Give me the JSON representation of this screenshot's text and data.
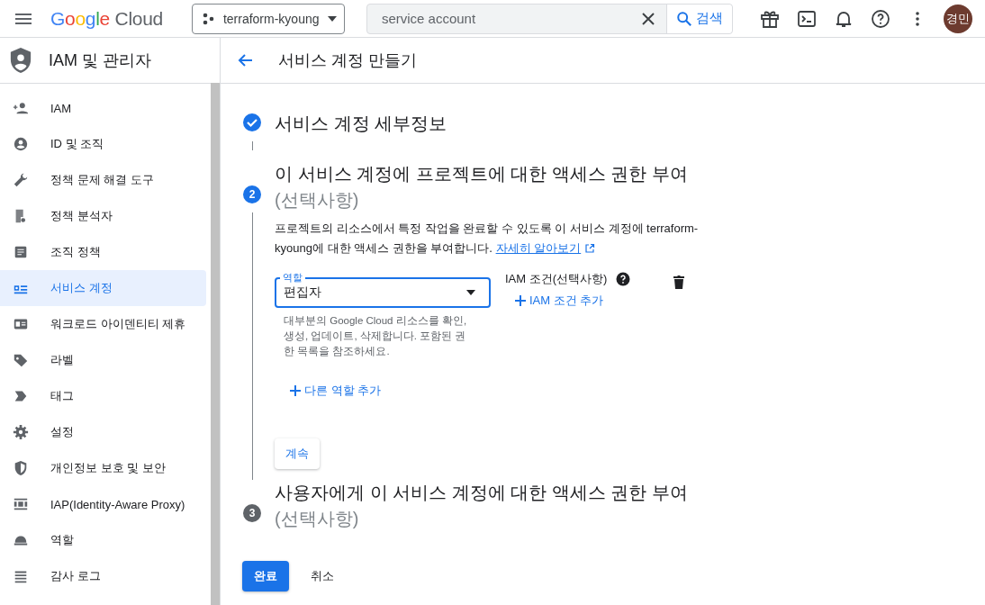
{
  "header": {
    "logo": "Google",
    "product": "Cloud",
    "project": "terraform-kyoung",
    "search": {
      "value": "service account"
    },
    "search_button": "검색",
    "avatar": "경민"
  },
  "sidebar": {
    "title": "IAM 및 관리자",
    "items": [
      {
        "label": "IAM",
        "selected": false
      },
      {
        "label": "ID 및 조직",
        "selected": false
      },
      {
        "label": "정책 문제 해결 도구",
        "selected": false
      },
      {
        "label": "정책 분석자",
        "selected": false
      },
      {
        "label": "조직 정책",
        "selected": false
      },
      {
        "label": "서비스 계정",
        "selected": true
      },
      {
        "label": "워크로드 아이덴티티 제휴",
        "selected": false
      },
      {
        "label": "라벨",
        "selected": false
      },
      {
        "label": "태그",
        "selected": false
      },
      {
        "label": "설정",
        "selected": false
      },
      {
        "label": "개인정보 보호 및 보안",
        "selected": false
      },
      {
        "label": "IAP(Identity-Aware Proxy)",
        "selected": false
      },
      {
        "label": "역할",
        "selected": false
      },
      {
        "label": "감사 로그",
        "selected": false
      }
    ]
  },
  "page": {
    "title": "서비스 계정 만들기"
  },
  "steps": [
    {
      "completed": true,
      "selected": false,
      "title": "서비스 계정 세부정보"
    },
    {
      "completed": false,
      "selected": true,
      "number": "2",
      "title": "이 서비스 계정에 프로젝트에 대한 액세스 권한 부여",
      "optional": "(선택사항)"
    },
    {
      "completed": false,
      "selected": false,
      "number": "3",
      "title": "사용자에게 이 서비스 계정에 대한 액세스 권한 부여",
      "optional": "(선택사항)"
    }
  ],
  "role_section": {
    "description": "프로젝트의 리소스에서 특정 작업을 완료할 수 있도록 이 서비스 계정에 terraform-kyoung에 대한 액세스 권한을 부여합니다.",
    "learn_more": "자세히 알아보기",
    "role_field": {
      "label": "역할",
      "value": "편집자",
      "helper": "대부분의 Google Cloud 리소스를 확인, 생성, 업데이트, 삭제합니다. 포함된 권한 목록을 참조하세요."
    },
    "condition_label": "IAM 조건(선택사항)",
    "add_condition": "IAM 조건 추가",
    "add_role": "다른 역할 추가",
    "continue": "계속"
  },
  "actions": {
    "done": "완료",
    "cancel": "취소"
  }
}
